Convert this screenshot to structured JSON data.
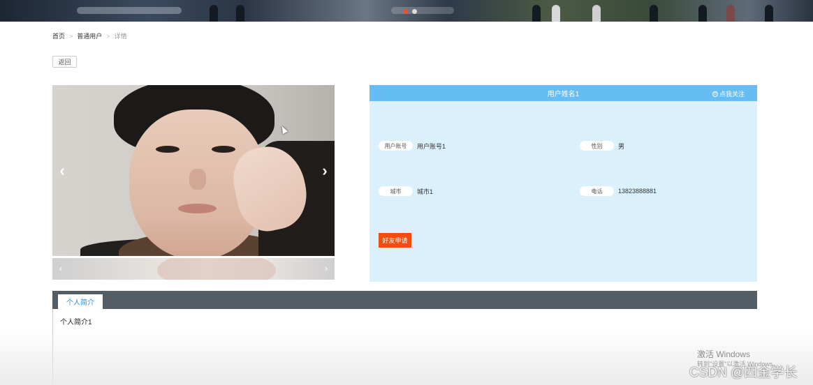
{
  "breadcrumb": {
    "home": "首页",
    "section": "普通用户",
    "current": "详情",
    "separator": ">"
  },
  "toolbar": {
    "back_label": "返回"
  },
  "carousel": {
    "prev_arrow": "‹",
    "next_arrow": "›",
    "thumb_prev": "‹",
    "thumb_next": "›"
  },
  "profile": {
    "name": "用户姓名1",
    "follow_label": "点我关注",
    "follow_icon": "⊙",
    "fields": [
      {
        "label": "用户账号",
        "value": "用户账号1"
      },
      {
        "label": "性别",
        "value": "男"
      },
      {
        "label": "城市",
        "value": "城市1"
      },
      {
        "label": "电话",
        "value": "13823888881"
      }
    ],
    "friend_request_label": "好友申请"
  },
  "tabs": {
    "active_label": "个人简介",
    "content": "个人简介1"
  },
  "watermarks": {
    "windows_title": "激活 Windows",
    "windows_sub": "转到\"设置\"以激活 Windows。",
    "csdn": "CSDN @四金学长"
  },
  "colors": {
    "header_blue": "#66bdf3",
    "panel_bg": "#daf0fd",
    "friend_button": "#f04d0f",
    "tabbar": "#535d66",
    "tab_text": "#2d8ee0"
  }
}
